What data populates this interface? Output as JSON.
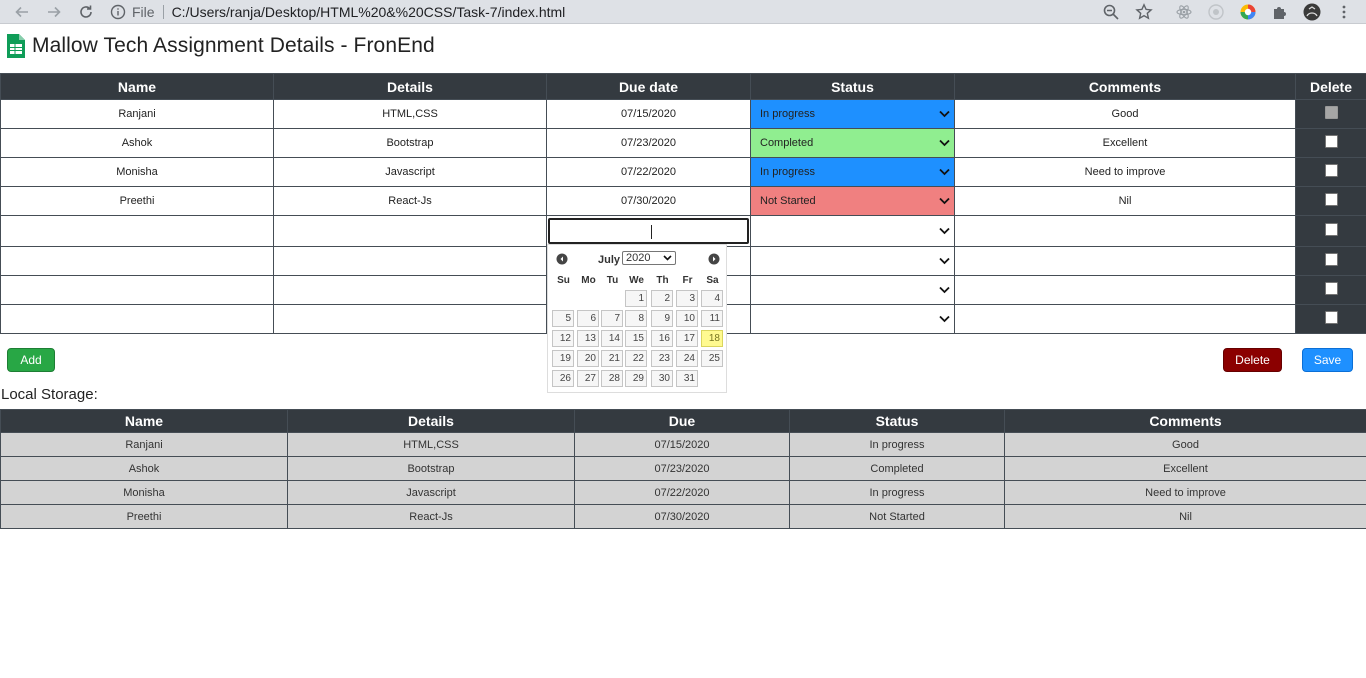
{
  "browser": {
    "file_label": "File",
    "url": "C:/Users/ranja/Desktop/HTML%20&%20CSS/Task-7/index.html"
  },
  "page": {
    "title": "Mallow Tech Assignment Details - FronEnd"
  },
  "main_table": {
    "headers": [
      "Name",
      "Details",
      "Due date",
      "Status",
      "Comments",
      "Delete"
    ],
    "rows": [
      {
        "name": "Ranjani",
        "details": "HTML,CSS",
        "due": "07/15/2020",
        "status": "In progress",
        "comments": "Good"
      },
      {
        "name": "Ashok",
        "details": "Bootstrap",
        "due": "07/23/2020",
        "status": "Completed",
        "comments": "Excellent"
      },
      {
        "name": "Monisha",
        "details": "Javascript",
        "due": "07/22/2020",
        "status": "In progress",
        "comments": "Need to improve"
      },
      {
        "name": "Preethi",
        "details": "React-Js",
        "due": "07/30/2020",
        "status": "Not Started",
        "comments": "Nil"
      }
    ]
  },
  "status_colors": {
    "in_progress": "#1e90ff",
    "completed": "#90ee90",
    "not_started": "#f08080"
  },
  "buttons": {
    "add": "Add",
    "delete": "Delete",
    "save": "Save"
  },
  "local_storage": {
    "title": "Local Storage:",
    "headers": [
      "Name",
      "Details",
      "Due",
      "Status",
      "Comments"
    ],
    "rows": [
      [
        "Ranjani",
        "HTML,CSS",
        "07/15/2020",
        "In progress",
        "Good"
      ],
      [
        "Ashok",
        "Bootstrap",
        "07/23/2020",
        "Completed",
        "Excellent"
      ],
      [
        "Monisha",
        "Javascript",
        "07/22/2020",
        "In progress",
        "Need to improve"
      ],
      [
        "Preethi",
        "React-Js",
        "07/30/2020",
        "Not Started",
        "Nil"
      ]
    ]
  },
  "datepicker": {
    "month": "July",
    "year": "2020",
    "weekdays": [
      "Su",
      "Mo",
      "Tu",
      "We",
      "Th",
      "Fr",
      "Sa"
    ],
    "days": [
      "1",
      "2",
      "3",
      "4",
      "5",
      "6",
      "7",
      "8",
      "9",
      "10",
      "11",
      "12",
      "13",
      "14",
      "15",
      "16",
      "17",
      "18",
      "19",
      "20",
      "21",
      "22",
      "23",
      "24",
      "25",
      "26",
      "27",
      "28",
      "29",
      "30",
      "31"
    ],
    "today": "18"
  }
}
